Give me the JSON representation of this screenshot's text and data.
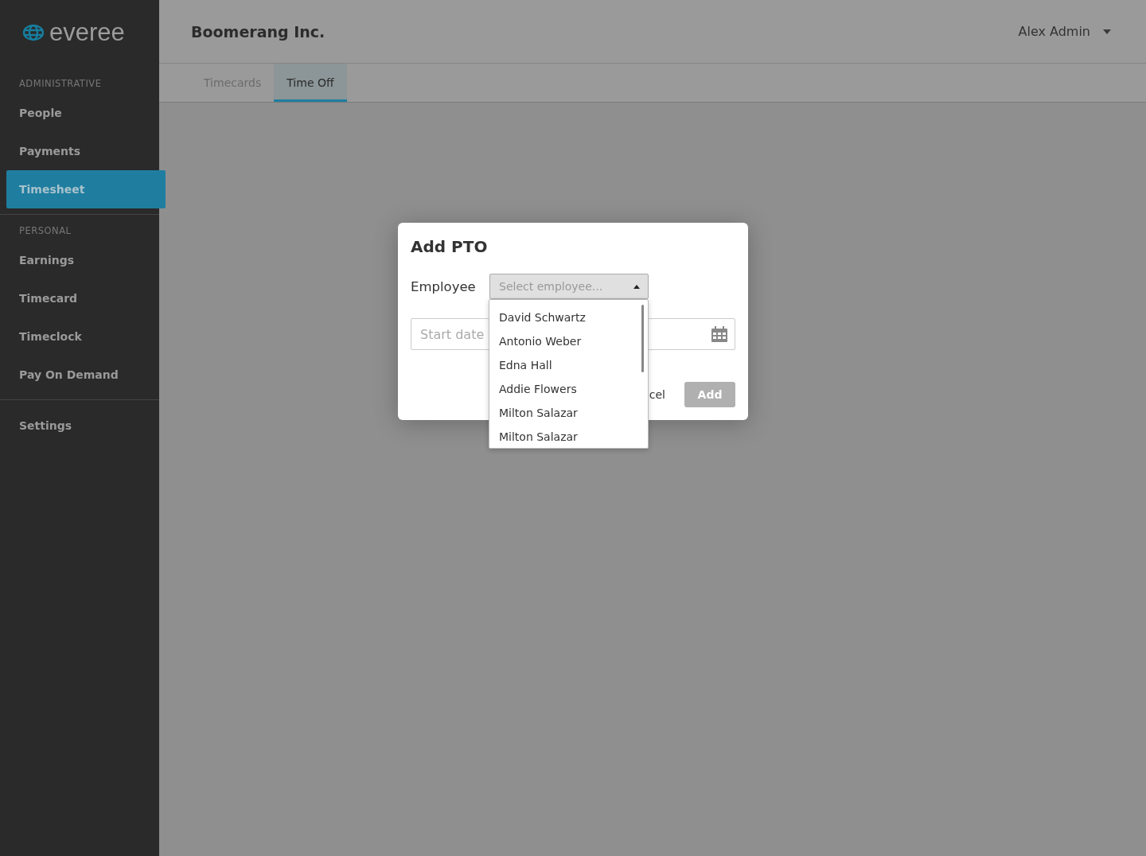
{
  "sidebar": {
    "logo": "everee",
    "sections": [
      {
        "heading": "ADMINISTRATIVE",
        "items": [
          {
            "label": "People",
            "selected": false
          },
          {
            "label": "Payments",
            "selected": false
          },
          {
            "label": "Timesheet",
            "selected": true
          }
        ]
      },
      {
        "heading": "PERSONAL",
        "items": [
          {
            "label": "Earnings",
            "selected": false
          },
          {
            "label": "Timecard",
            "selected": false
          },
          {
            "label": "Timeclock",
            "selected": false
          },
          {
            "label": "Pay On Demand",
            "selected": false
          }
        ]
      },
      {
        "items": [
          {
            "label": "Settings",
            "selected": false
          }
        ]
      }
    ]
  },
  "header": {
    "company": "Boomerang Inc.",
    "user": "Alex Admin"
  },
  "tabs": [
    {
      "label": "Timecards",
      "selected": false
    },
    {
      "label": "Time Off",
      "selected": true
    }
  ],
  "dialog": {
    "title": "Add PTO",
    "employee_label": "Employee",
    "select": {
      "placeholder": "Select employee...",
      "expanded": true
    },
    "start_date": {
      "placeholder": "Start date"
    },
    "options": [
      "David Schwartz",
      "Antonio Weber",
      "Edna Hall",
      "Addie Flowers",
      "Milton Salazar",
      "Milton Salazar"
    ],
    "cancel_button": "cel",
    "add_button": {
      "label": "Add",
      "disabled": true
    }
  }
}
